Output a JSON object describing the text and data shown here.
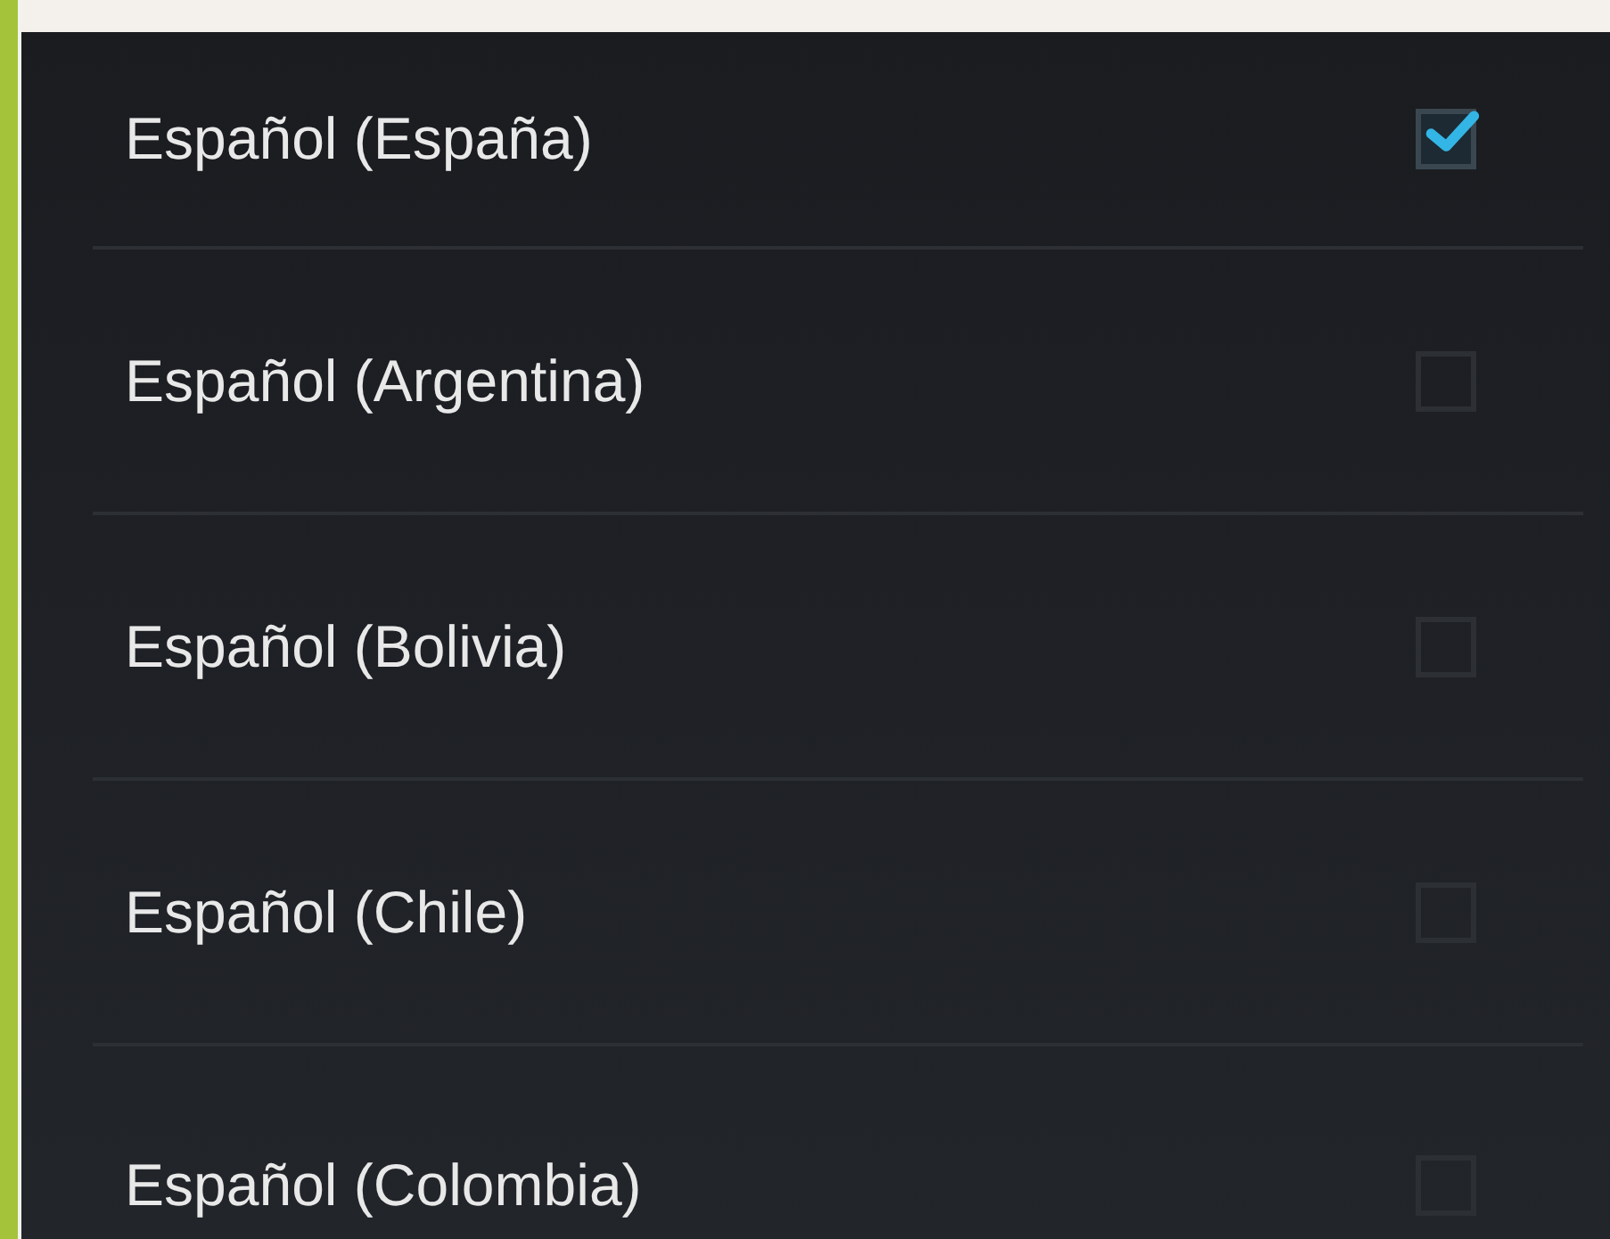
{
  "languages": [
    {
      "label": "Español (España)",
      "checked": true
    },
    {
      "label": "Español (Argentina)",
      "checked": false
    },
    {
      "label": "Español (Bolivia)",
      "checked": false
    },
    {
      "label": "Español (Chile)",
      "checked": false
    },
    {
      "label": "Español (Colombia)",
      "checked": false
    }
  ]
}
